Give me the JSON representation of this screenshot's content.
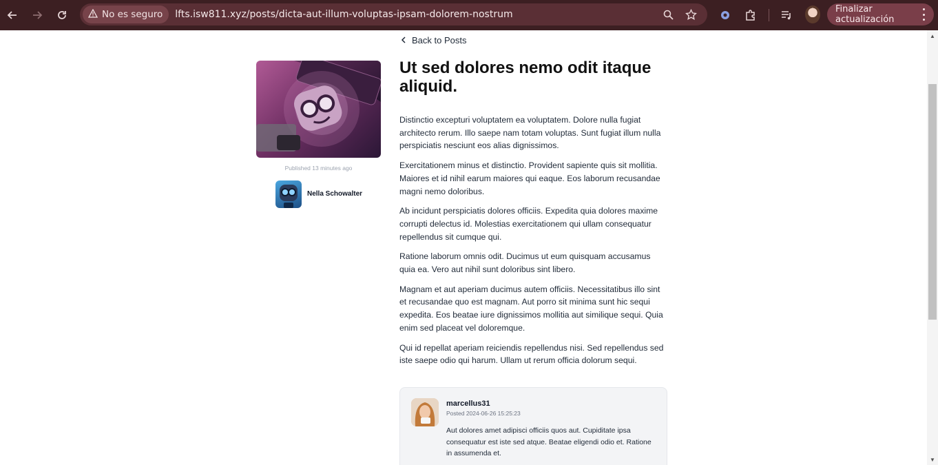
{
  "browser": {
    "security_label": "No es seguro",
    "url": "lfts.isw811.xyz/posts/dicta-aut-illum-voluptas-ipsam-dolorem-nostrum",
    "update_button_label": "Finalizar actualización",
    "icons": [
      "back-icon",
      "forward-icon",
      "reload-icon",
      "warning-icon",
      "zoom-icon",
      "star-icon",
      "extension-gear-icon",
      "puzzle-icon",
      "media-queue-icon",
      "profile-avatar",
      "more-vert-icon"
    ]
  },
  "page": {
    "back_link_label": "Back to Posts",
    "post": {
      "title": "Ut sed dolores nemo odit itaque aliquid.",
      "published": "Published 13 minutes ago",
      "author_name": "Nella Schowalter",
      "paragraphs": [
        "Distinctio excepturi voluptatem ea voluptatem. Dolore nulla fugiat architecto rerum. Illo saepe nam totam voluptas. Sunt fugiat illum nulla perspiciatis nesciunt eos alias dignissimos.",
        "Exercitationem minus et distinctio. Provident sapiente quis sit mollitia. Maiores et id nihil earum maiores qui eaque. Eos laborum recusandae magni nemo doloribus.",
        "Ab incidunt perspiciatis dolores officiis. Expedita quia dolores maxime corrupti delectus id. Molestias exercitationem qui ullam consequatur repellendus sit cumque qui.",
        "Ratione laborum omnis odit. Ducimus ut eum quisquam accusamus quia ea. Vero aut nihil sunt doloribus sint libero.",
        "Magnam et aut aperiam ducimus autem officiis. Necessitatibus illo sint et recusandae quo est magnam. Aut porro sit minima sunt hic sequi expedita. Eos beatae iure dignissimos mollitia aut similique sequi. Quia enim sed placeat vel doloremque.",
        "Qui id repellat aperiam reiciendis repellendus nisi. Sed repellendus sed iste saepe odio qui harum. Ullam ut rerum officia dolorum sequi."
      ]
    },
    "comments": [
      {
        "username": "marcellus31",
        "posted": "Posted 2024-06-26 15:25:23",
        "text": "Aut dolores amet adipisci officiis quos aut. Cupiditate ipsa consequatur est iste sed atque. Beatae eligendi odio et. Ratione in assumenda et."
      }
    ]
  }
}
